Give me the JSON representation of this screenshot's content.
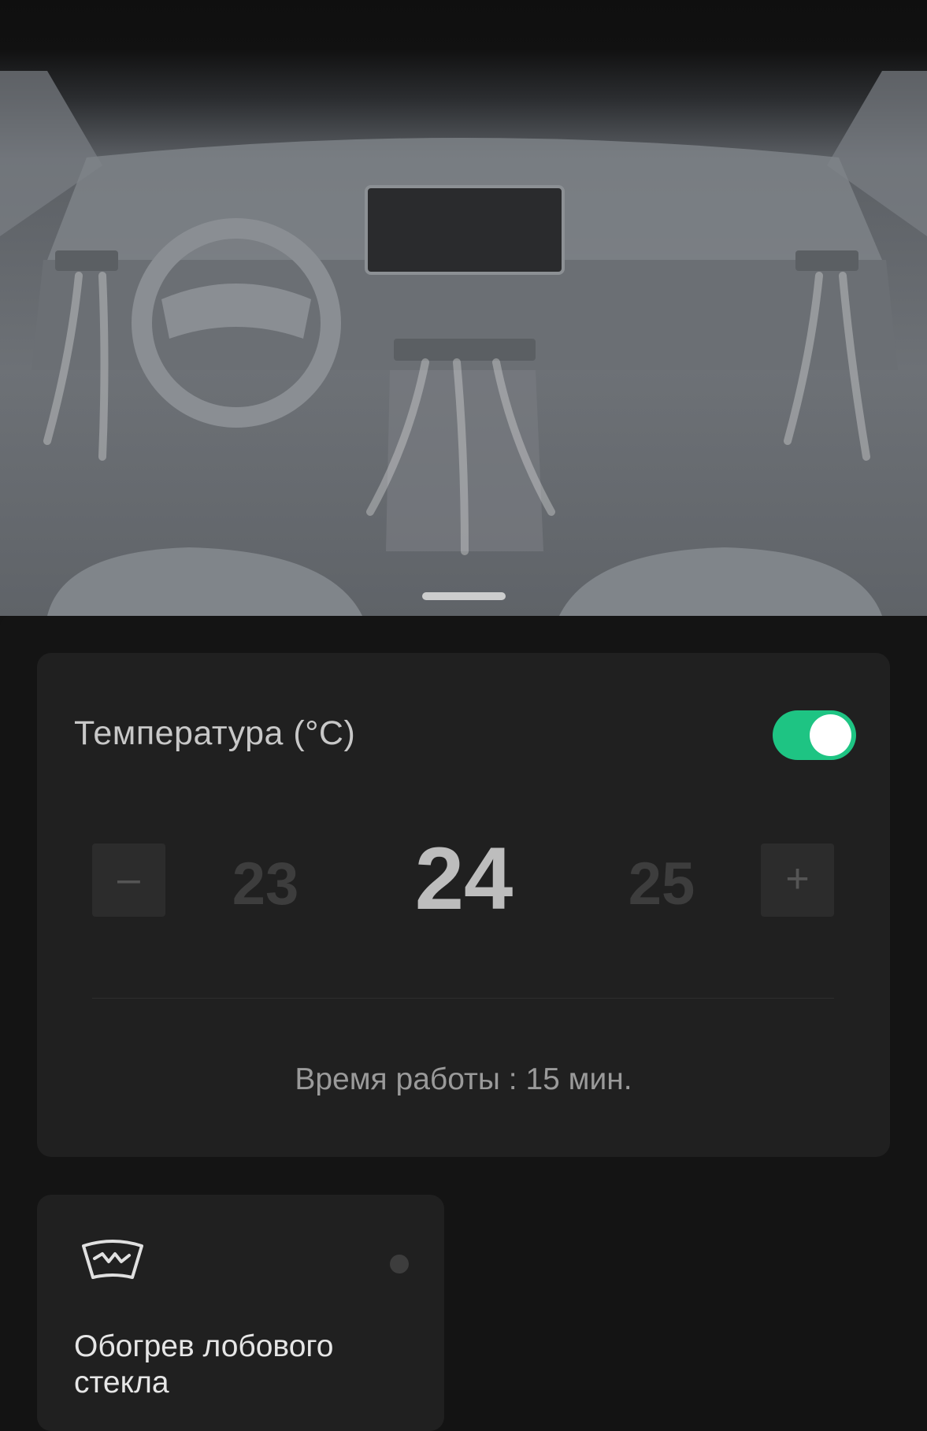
{
  "temperature": {
    "title": "Температура (°C)",
    "enabled": true,
    "prev_value": "23",
    "current_value": "24",
    "next_value": "25",
    "decrease_label": "–",
    "increase_label": "+",
    "runtime_text": "Время работы : 15 мин.",
    "accent_color": "#1ec483"
  },
  "windshield": {
    "label": "Обогрев лобового стекла",
    "icon": "windshield-heat-icon"
  }
}
